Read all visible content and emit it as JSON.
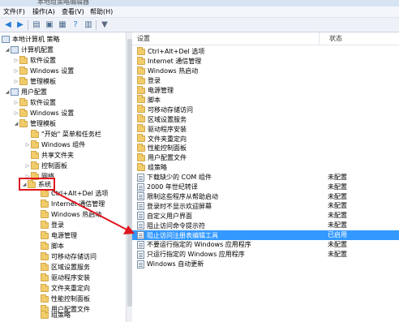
{
  "window": {
    "title": "本地组策略编辑器"
  },
  "menu": [
    "文件(F)",
    "操作(A)",
    "查看(V)",
    "帮助(H)"
  ],
  "toolbar": {
    "back_icon": "back-arrow-icon",
    "forward_icon": "forward-arrow-icon",
    "filter_icon": "filter-icon"
  },
  "tree": {
    "root": "本地计算机 策略",
    "computer_config": "计算机配置",
    "software_settings_1": "软件设置",
    "windows_settings_1": "Windows 设置",
    "admin_templates_1": "管理模板",
    "user_config": "用户配置",
    "software_settings_2": "软件设置",
    "windows_settings_2": "Windows 设置",
    "admin_templates_2": "管理模板",
    "start_menu": "\"开始\" 菜单和任务栏",
    "windows_components": "Windows 组件",
    "shared_folders": "共享文件夹",
    "control_panel": "控制面板",
    "network": "网络",
    "system": "系统",
    "sys_children": [
      "Ctrl+Alt+Del 选项",
      "Internet 通信管理",
      "Windows 热启动",
      "登录",
      "电源管理",
      "脚本",
      "可移动存储访问",
      "区域设置服务",
      "驱动程序安装",
      "文件夹重定向",
      "性能控制面板",
      "用户配置文件",
      "组策略"
    ]
  },
  "list": {
    "col_setting": "设置",
    "col_status": "状态",
    "folders": [
      "Ctrl+Alt+Del 选项",
      "Internet 通信管理",
      "Windows 热启动",
      "登录",
      "电源管理",
      "脚本",
      "可移动存储访问",
      "区域设置服务",
      "驱动程序安装",
      "文件夹重定向",
      "性能控制面板",
      "用户配置文件",
      "组策略"
    ],
    "policies": [
      {
        "name": "下载缺少的 COM 组件",
        "status": "未配置"
      },
      {
        "name": "2000 年世纪转译",
        "status": "未配置"
      },
      {
        "name": "限制这些程序从帮助启动",
        "status": "未配置"
      },
      {
        "name": "登录时不显示欢迎屏幕",
        "status": "未配置"
      },
      {
        "name": "自定义用户界面",
        "status": "未配置"
      },
      {
        "name": "阻止访问命令提示符",
        "status": "未配置"
      },
      {
        "name": "阻止访问注册表编辑工具",
        "status": "已启用"
      },
      {
        "name": "不要运行指定的 Windows 应用程序",
        "status": "未配置"
      },
      {
        "name": "只运行指定的 Windows 应用程序",
        "status": "未配置"
      },
      {
        "name": "Windows 自动更新",
        "status": ""
      }
    ]
  },
  "colors": {
    "selection": "#3399ff",
    "highlight_box": "#e0141e",
    "arrow": "#e0141e"
  }
}
